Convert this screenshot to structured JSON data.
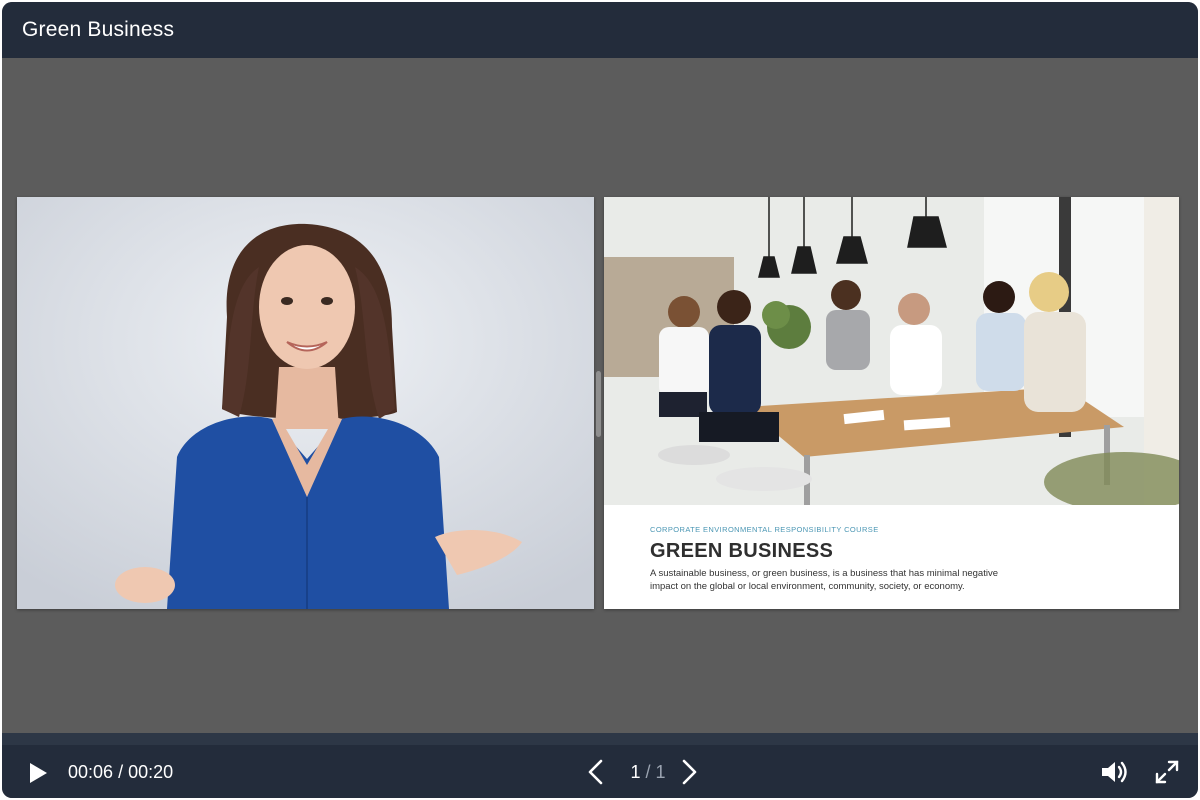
{
  "window": {
    "title": "Green Business"
  },
  "video": {
    "subject": "presenter-photo"
  },
  "slide": {
    "kicker": "CORPORATE ENVIRONMENTAL RESPONSIBILITY COURSE",
    "heading": "GREEN BUSINESS",
    "body": "A sustainable business, or green business, is a business that has minimal negative impact on the global or local environment, community, society, or economy."
  },
  "player": {
    "current_time": "00:06",
    "separator": "/",
    "duration": "00:20",
    "page_current": "1",
    "page_separator": "/",
    "page_total": "1",
    "icons": {
      "play": "play-icon",
      "prev": "chevron-left-icon",
      "next": "chevron-right-icon",
      "volume": "volume-icon",
      "fullscreen": "fullscreen-icon"
    },
    "colors": {
      "titlebar": "#232c3b",
      "stage": "#5c5c5c",
      "kicker": "#4c97b4"
    }
  }
}
